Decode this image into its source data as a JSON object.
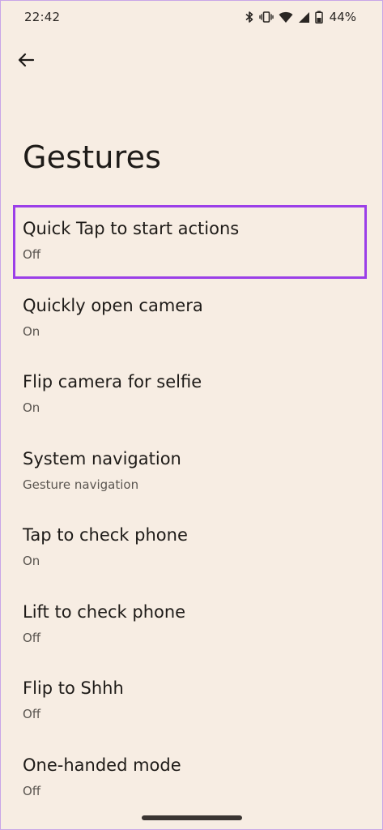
{
  "status_bar": {
    "time": "22:42",
    "battery": "44%",
    "icons": [
      "bluetooth-icon",
      "vibrate-icon",
      "wifi-icon",
      "signal-icon",
      "battery-icon"
    ]
  },
  "header": {
    "back_icon": "arrow-left-icon",
    "title": "Gestures"
  },
  "settings": [
    {
      "title": "Quick Tap to start actions",
      "subtitle": "Off",
      "highlighted": true
    },
    {
      "title": "Quickly open camera",
      "subtitle": "On"
    },
    {
      "title": "Flip camera for selfie",
      "subtitle": "On"
    },
    {
      "title": "System navigation",
      "subtitle": "Gesture navigation"
    },
    {
      "title": "Tap to check phone",
      "subtitle": "On"
    },
    {
      "title": "Lift to check phone",
      "subtitle": "Off"
    },
    {
      "title": "Flip to Shhh",
      "subtitle": "Off"
    },
    {
      "title": "One-handed mode",
      "subtitle": "Off"
    }
  ],
  "colors": {
    "background": "#f7ede3",
    "highlight_border": "#9b3fe8",
    "text_primary": "#1e1b18",
    "text_secondary": "#5a5550"
  }
}
